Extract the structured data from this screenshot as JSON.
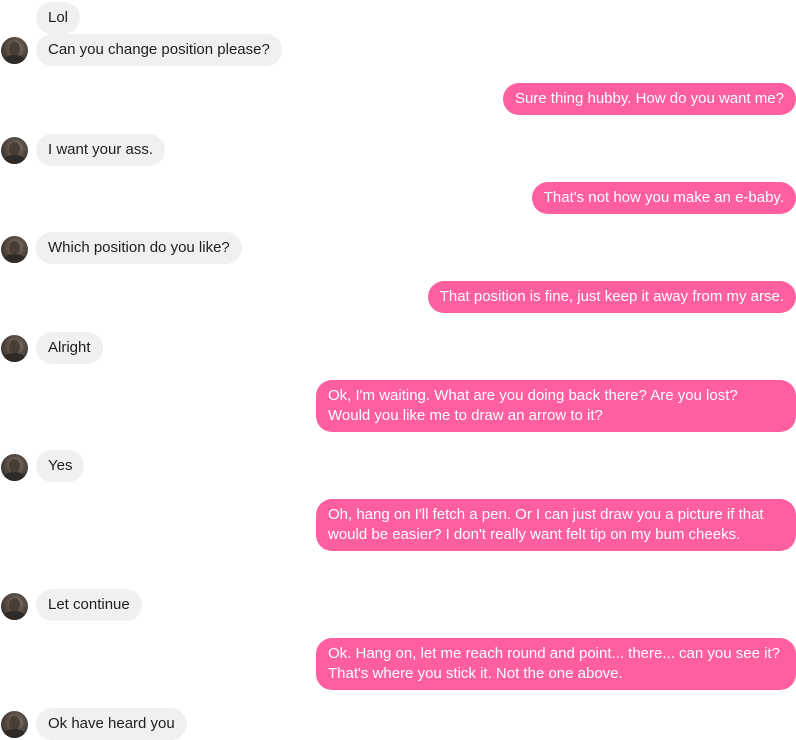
{
  "contact": {
    "avatar_icon": "contact-avatar-icon"
  },
  "colors": {
    "incoming_bg": "#f0f0f0",
    "outgoing_bg": "#ff5ea0"
  },
  "messages": [
    {
      "dir": "in",
      "text": "Lol",
      "avatar": false
    },
    {
      "dir": "in",
      "text": "Can you change position please?",
      "avatar": true
    },
    {
      "dir": "out",
      "text": "Sure thing hubby. How do you want me?"
    },
    {
      "dir": "in",
      "text": "I want your ass.",
      "avatar": true
    },
    {
      "dir": "out",
      "text": "That's not how you make an e-baby."
    },
    {
      "dir": "in",
      "text": "Which position do you like?",
      "avatar": true
    },
    {
      "dir": "out",
      "text": "That position is fine, just keep it away from my arse."
    },
    {
      "dir": "in",
      "text": "Alright",
      "avatar": true
    },
    {
      "dir": "out",
      "text": "Ok, I'm waiting. What are you doing back there? Are you lost? Would you like me to draw an arrow to it?"
    },
    {
      "dir": "in",
      "text": "Yes",
      "avatar": true
    },
    {
      "dir": "out",
      "text": "Oh, hang on I'll fetch a pen. Or I can just draw you a picture if that would be easier? I don't really want felt tip on my bum cheeks."
    },
    {
      "dir": "in",
      "text": "Let continue",
      "avatar": true
    },
    {
      "dir": "out",
      "text": "Ok. Hang on, let me reach round and point... there... can you see it? That's where you stick it. Not the one above."
    },
    {
      "dir": "in",
      "text": "Ok have heard you",
      "avatar": true
    }
  ]
}
